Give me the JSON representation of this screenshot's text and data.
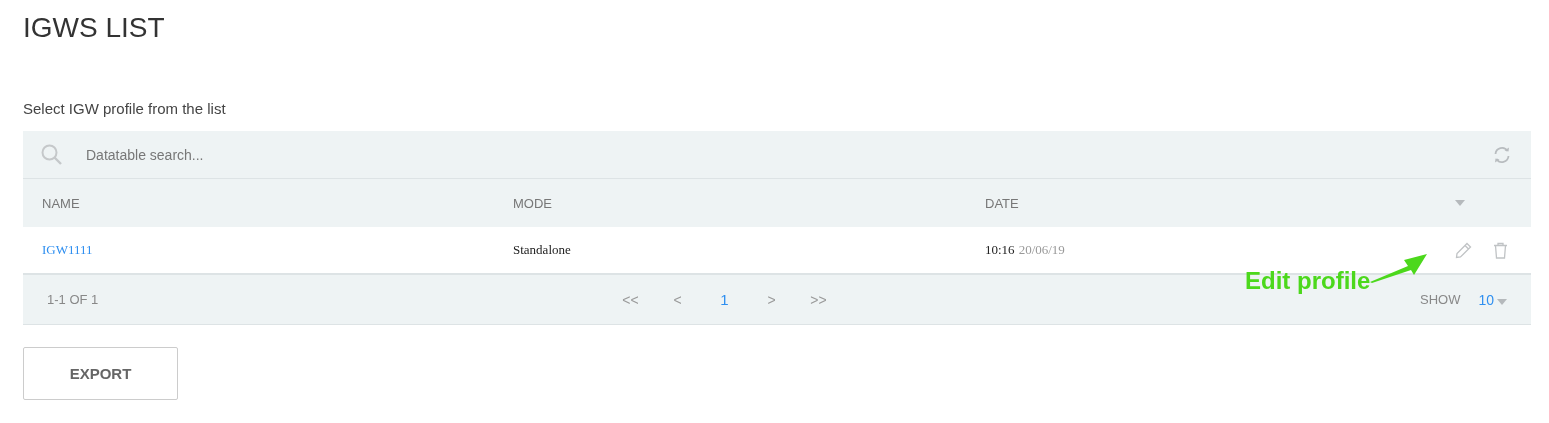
{
  "page_title": "IGWS LIST",
  "instruction": "Select IGW profile from the list",
  "table": {
    "search": {
      "placeholder": "Datatable search..."
    },
    "columns": [
      "NAME",
      "MODE",
      "DATE"
    ],
    "rows": [
      {
        "name": "IGW1111",
        "mode": "Standalone",
        "time": "10:16",
        "date": "20/06/19"
      }
    ],
    "footer": {
      "range": "1-1 OF 1",
      "pages": [
        {
          "label": "<<",
          "selected": false
        },
        {
          "label": "<",
          "selected": false
        },
        {
          "label": "1",
          "selected": true
        },
        {
          "label": ">",
          "selected": false
        },
        {
          "label": ">>",
          "selected": false
        }
      ],
      "show_label": "SHOW",
      "page_size": "10"
    }
  },
  "annotation": {
    "label": "Edit profile",
    "color": "#4cd81c"
  },
  "export_button": "EXPORT"
}
